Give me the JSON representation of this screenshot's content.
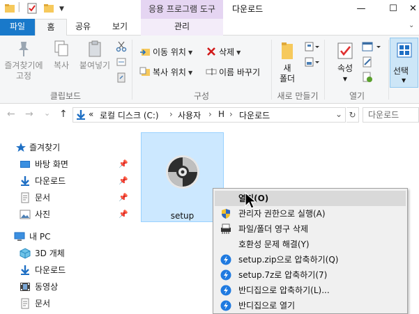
{
  "titlebar": {
    "context_tab_header": "응용 프로그램 도구",
    "window_title": "다운로드",
    "minimize": "—",
    "maximize": "☐",
    "close": "✕"
  },
  "ribbon_tabs": {
    "file": "파일",
    "home": "홈",
    "share": "공유",
    "view": "보기",
    "manage": "관리"
  },
  "ribbon": {
    "clipboard": {
      "pin_quick_access": [
        "즐겨찾기에",
        "고정"
      ],
      "copy": "복사",
      "paste": "붙여넣기",
      "group": "클립보드"
    },
    "organize": {
      "move_to": "이동 위치",
      "copy_to": "복사 위치",
      "delete": "삭제",
      "rename": "이름 바꾸기",
      "group": "구성"
    },
    "new": {
      "new_folder": [
        "새",
        "폴더"
      ],
      "group": "새로 만들기"
    },
    "open": {
      "properties": "속성",
      "group": "열기"
    },
    "select": {
      "select": "선택"
    }
  },
  "address": {
    "back": "←",
    "forward": "→",
    "recent": "⌄",
    "up": "↑",
    "overflow": "«",
    "path": [
      "로컬 디스크 (C:)",
      "사용자",
      "H",
      "다운로드"
    ],
    "separator": "›",
    "dropdown": "⌄",
    "refresh": "↻",
    "search_placeholder": "다운로드"
  },
  "nav_pane": {
    "quick_access": "즐겨찾기",
    "desktop": "바탕 화면",
    "downloads": "다운로드",
    "documents": "문서",
    "pictures": "사진",
    "this_pc": "내 PC",
    "objects3d": "3D 개체",
    "pc_downloads": "다운로드",
    "videos": "동영상",
    "pc_documents": "문서"
  },
  "files": [
    {
      "name": "setup"
    }
  ],
  "context_menu": {
    "items": [
      "열기(O)",
      "관리자 권한으로 실행(A)",
      "파일/폴더 영구 삭제",
      "호환성 문제 해결(Y)",
      "setup.zip으로 압축하기(Q)",
      "setup.7z로 압축하기(7)",
      "반디집으로 압축하기(L)...",
      "반디집으로 열기"
    ],
    "highlighted_index": 0
  },
  "colors": {
    "file_tab": "#1979ca",
    "context_tab": "#e5d5f2",
    "selection": "#cce8ff",
    "menu_bg": "#f0f0f0"
  }
}
